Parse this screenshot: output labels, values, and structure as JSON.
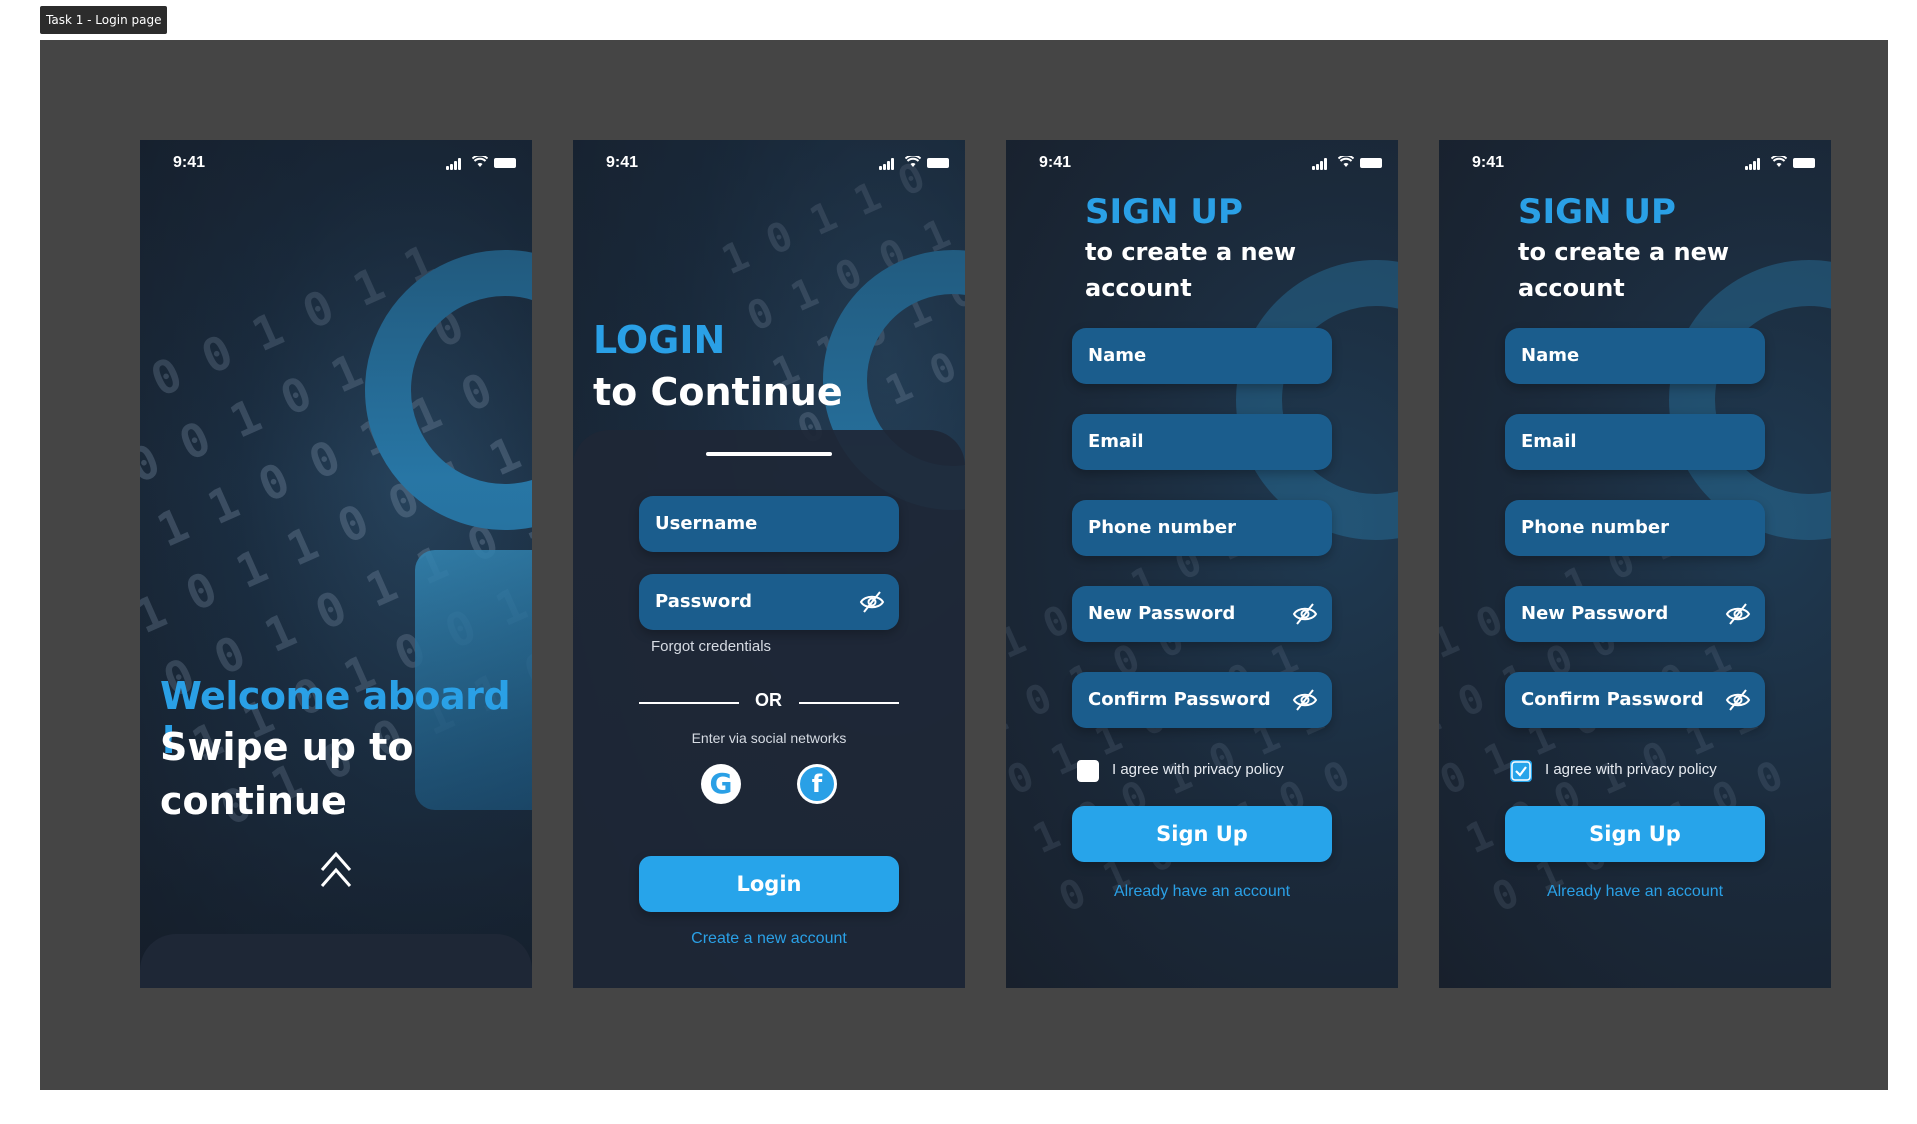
{
  "frame_label": "Task 1 - Login page",
  "colors": {
    "accent": "#27a4ea",
    "field_bg": "#1b5d8d",
    "phone_bg": "#1a2231",
    "canvas_bg": "#454545"
  },
  "status_bar": {
    "time": "9:41"
  },
  "welcome": {
    "title": "Welcome aboard !",
    "subtitle": "Swipe up to continue",
    "icon": "double-chevron-up-icon"
  },
  "login": {
    "title": "LOGIN",
    "subtitle": "to Continue",
    "username_placeholder": "Username",
    "password_placeholder": "Password",
    "forgot": "Forgot credentials",
    "or": "OR",
    "social_text": "Enter via social networks",
    "google_icon": "google-icon",
    "facebook_icon": "facebook-icon",
    "button": "Login",
    "create_link": "Create a new account"
  },
  "signup": {
    "title": "SIGN UP",
    "subtitle": "to create a new account",
    "fields": {
      "name": "Name",
      "email": "Email",
      "phone": "Phone number",
      "new_password": "New Password",
      "confirm_password": "Confirm Password"
    },
    "agree": "I agree with privacy policy",
    "button": "Sign Up",
    "existing_link": "Already have an account",
    "screens": [
      {
        "privacy_checked": false
      },
      {
        "privacy_checked": true
      }
    ]
  }
}
